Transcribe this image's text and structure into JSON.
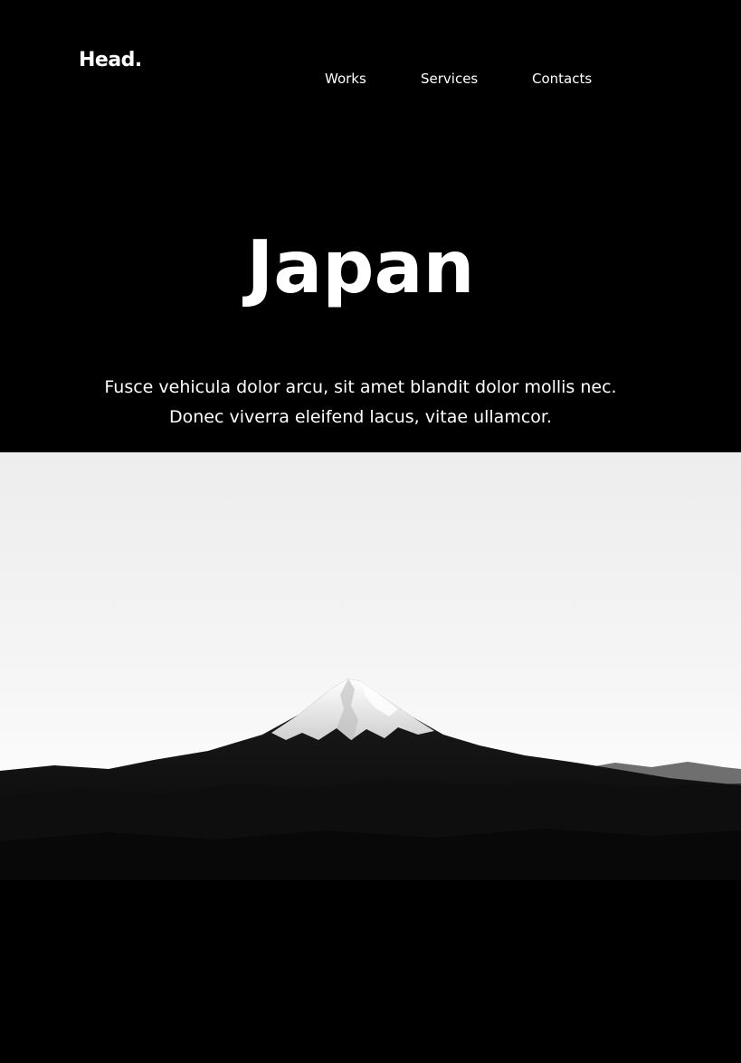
{
  "header": {
    "logo": "Head.",
    "nav": [
      {
        "label": "Works"
      },
      {
        "label": "Services"
      },
      {
        "label": "Contacts"
      }
    ]
  },
  "hero": {
    "title": "Japan",
    "subtitle_line1": "Fusce vehicula dolor arcu, sit amet blandit dolor mollis nec.",
    "subtitle_line2": "Donec viverra eleifend lacus, vitae ullamcor."
  },
  "image": {
    "subject": "mountain-photo"
  },
  "colors": {
    "background": "#000000",
    "text": "#ffffff"
  }
}
